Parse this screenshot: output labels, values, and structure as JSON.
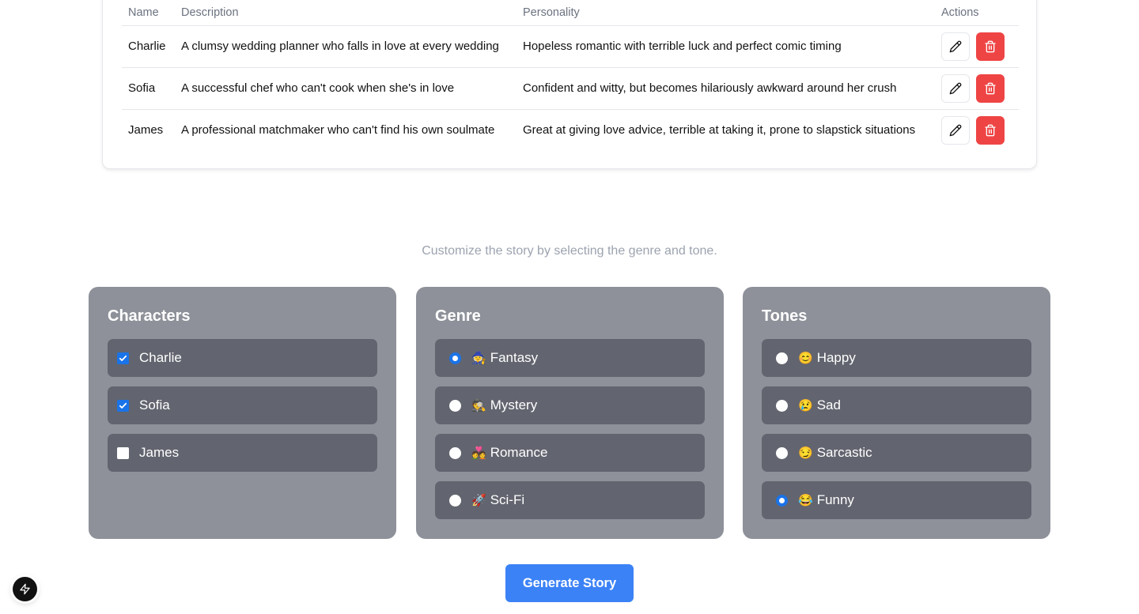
{
  "table": {
    "headers": {
      "name": "Name",
      "description": "Description",
      "personality": "Personality",
      "actions": "Actions"
    },
    "rows": [
      {
        "name": "Charlie",
        "description": "A clumsy wedding planner who falls in love at every wedding",
        "personality": "Hopeless romantic with terrible luck and perfect comic timing"
      },
      {
        "name": "Sofia",
        "description": "A successful chef who can't cook when she's in love",
        "personality": "Confident and witty, but becomes hilariously awkward around her crush"
      },
      {
        "name": "James",
        "description": "A professional matchmaker who can't find his own soulmate",
        "personality": "Great at giving love advice, terrible at taking it, prone to slapstick situations"
      }
    ]
  },
  "subtitle": "Customize the story by selecting the genre and tone.",
  "characters": {
    "title": "Characters",
    "items": [
      {
        "label": "Charlie",
        "checked": true
      },
      {
        "label": "Sofia",
        "checked": true
      },
      {
        "label": "James",
        "checked": false
      }
    ]
  },
  "genre": {
    "title": "Genre",
    "items": [
      {
        "emoji": "🧙",
        "label": "Fantasy",
        "selected": true
      },
      {
        "emoji": "🕵️",
        "label": "Mystery",
        "selected": false
      },
      {
        "emoji": "💑",
        "label": "Romance",
        "selected": false
      },
      {
        "emoji": "🚀",
        "label": "Sci-Fi",
        "selected": false
      }
    ]
  },
  "tones": {
    "title": "Tones",
    "items": [
      {
        "emoji": "😊",
        "label": "Happy",
        "selected": false
      },
      {
        "emoji": "😢",
        "label": "Sad",
        "selected": false
      },
      {
        "emoji": "😏",
        "label": "Sarcastic",
        "selected": false
      },
      {
        "emoji": "😂",
        "label": "Funny",
        "selected": true
      }
    ]
  },
  "generate_label": "Generate Story",
  "colors": {
    "accent": "#3b82f6",
    "danger": "#ef4444",
    "panel": "#8e9199",
    "option": "#62656f"
  },
  "icons": {
    "edit": "pencil-icon",
    "delete": "trash-icon",
    "fab": "lightning-bolt-icon"
  }
}
